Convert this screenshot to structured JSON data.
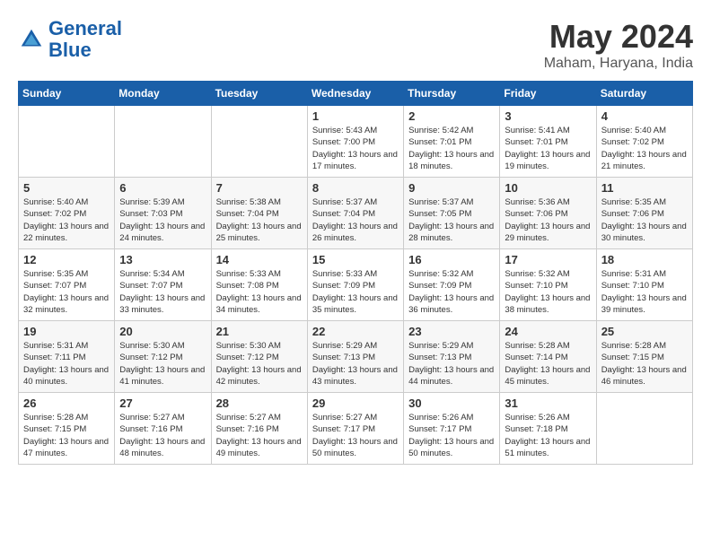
{
  "header": {
    "logo_line1": "General",
    "logo_line2": "Blue",
    "month": "May 2024",
    "location": "Maham, Haryana, India"
  },
  "weekdays": [
    "Sunday",
    "Monday",
    "Tuesday",
    "Wednesday",
    "Thursday",
    "Friday",
    "Saturday"
  ],
  "weeks": [
    [
      {
        "day": "",
        "sunrise": "",
        "sunset": "",
        "daylight": ""
      },
      {
        "day": "",
        "sunrise": "",
        "sunset": "",
        "daylight": ""
      },
      {
        "day": "",
        "sunrise": "",
        "sunset": "",
        "daylight": ""
      },
      {
        "day": "1",
        "sunrise": "Sunrise: 5:43 AM",
        "sunset": "Sunset: 7:00 PM",
        "daylight": "Daylight: 13 hours and 17 minutes."
      },
      {
        "day": "2",
        "sunrise": "Sunrise: 5:42 AM",
        "sunset": "Sunset: 7:01 PM",
        "daylight": "Daylight: 13 hours and 18 minutes."
      },
      {
        "day": "3",
        "sunrise": "Sunrise: 5:41 AM",
        "sunset": "Sunset: 7:01 PM",
        "daylight": "Daylight: 13 hours and 19 minutes."
      },
      {
        "day": "4",
        "sunrise": "Sunrise: 5:40 AM",
        "sunset": "Sunset: 7:02 PM",
        "daylight": "Daylight: 13 hours and 21 minutes."
      }
    ],
    [
      {
        "day": "5",
        "sunrise": "Sunrise: 5:40 AM",
        "sunset": "Sunset: 7:02 PM",
        "daylight": "Daylight: 13 hours and 22 minutes."
      },
      {
        "day": "6",
        "sunrise": "Sunrise: 5:39 AM",
        "sunset": "Sunset: 7:03 PM",
        "daylight": "Daylight: 13 hours and 24 minutes."
      },
      {
        "day": "7",
        "sunrise": "Sunrise: 5:38 AM",
        "sunset": "Sunset: 7:04 PM",
        "daylight": "Daylight: 13 hours and 25 minutes."
      },
      {
        "day": "8",
        "sunrise": "Sunrise: 5:37 AM",
        "sunset": "Sunset: 7:04 PM",
        "daylight": "Daylight: 13 hours and 26 minutes."
      },
      {
        "day": "9",
        "sunrise": "Sunrise: 5:37 AM",
        "sunset": "Sunset: 7:05 PM",
        "daylight": "Daylight: 13 hours and 28 minutes."
      },
      {
        "day": "10",
        "sunrise": "Sunrise: 5:36 AM",
        "sunset": "Sunset: 7:06 PM",
        "daylight": "Daylight: 13 hours and 29 minutes."
      },
      {
        "day": "11",
        "sunrise": "Sunrise: 5:35 AM",
        "sunset": "Sunset: 7:06 PM",
        "daylight": "Daylight: 13 hours and 30 minutes."
      }
    ],
    [
      {
        "day": "12",
        "sunrise": "Sunrise: 5:35 AM",
        "sunset": "Sunset: 7:07 PM",
        "daylight": "Daylight: 13 hours and 32 minutes."
      },
      {
        "day": "13",
        "sunrise": "Sunrise: 5:34 AM",
        "sunset": "Sunset: 7:07 PM",
        "daylight": "Daylight: 13 hours and 33 minutes."
      },
      {
        "day": "14",
        "sunrise": "Sunrise: 5:33 AM",
        "sunset": "Sunset: 7:08 PM",
        "daylight": "Daylight: 13 hours and 34 minutes."
      },
      {
        "day": "15",
        "sunrise": "Sunrise: 5:33 AM",
        "sunset": "Sunset: 7:09 PM",
        "daylight": "Daylight: 13 hours and 35 minutes."
      },
      {
        "day": "16",
        "sunrise": "Sunrise: 5:32 AM",
        "sunset": "Sunset: 7:09 PM",
        "daylight": "Daylight: 13 hours and 36 minutes."
      },
      {
        "day": "17",
        "sunrise": "Sunrise: 5:32 AM",
        "sunset": "Sunset: 7:10 PM",
        "daylight": "Daylight: 13 hours and 38 minutes."
      },
      {
        "day": "18",
        "sunrise": "Sunrise: 5:31 AM",
        "sunset": "Sunset: 7:10 PM",
        "daylight": "Daylight: 13 hours and 39 minutes."
      }
    ],
    [
      {
        "day": "19",
        "sunrise": "Sunrise: 5:31 AM",
        "sunset": "Sunset: 7:11 PM",
        "daylight": "Daylight: 13 hours and 40 minutes."
      },
      {
        "day": "20",
        "sunrise": "Sunrise: 5:30 AM",
        "sunset": "Sunset: 7:12 PM",
        "daylight": "Daylight: 13 hours and 41 minutes."
      },
      {
        "day": "21",
        "sunrise": "Sunrise: 5:30 AM",
        "sunset": "Sunset: 7:12 PM",
        "daylight": "Daylight: 13 hours and 42 minutes."
      },
      {
        "day": "22",
        "sunrise": "Sunrise: 5:29 AM",
        "sunset": "Sunset: 7:13 PM",
        "daylight": "Daylight: 13 hours and 43 minutes."
      },
      {
        "day": "23",
        "sunrise": "Sunrise: 5:29 AM",
        "sunset": "Sunset: 7:13 PM",
        "daylight": "Daylight: 13 hours and 44 minutes."
      },
      {
        "day": "24",
        "sunrise": "Sunrise: 5:28 AM",
        "sunset": "Sunset: 7:14 PM",
        "daylight": "Daylight: 13 hours and 45 minutes."
      },
      {
        "day": "25",
        "sunrise": "Sunrise: 5:28 AM",
        "sunset": "Sunset: 7:15 PM",
        "daylight": "Daylight: 13 hours and 46 minutes."
      }
    ],
    [
      {
        "day": "26",
        "sunrise": "Sunrise: 5:28 AM",
        "sunset": "Sunset: 7:15 PM",
        "daylight": "Daylight: 13 hours and 47 minutes."
      },
      {
        "day": "27",
        "sunrise": "Sunrise: 5:27 AM",
        "sunset": "Sunset: 7:16 PM",
        "daylight": "Daylight: 13 hours and 48 minutes."
      },
      {
        "day": "28",
        "sunrise": "Sunrise: 5:27 AM",
        "sunset": "Sunset: 7:16 PM",
        "daylight": "Daylight: 13 hours and 49 minutes."
      },
      {
        "day": "29",
        "sunrise": "Sunrise: 5:27 AM",
        "sunset": "Sunset: 7:17 PM",
        "daylight": "Daylight: 13 hours and 50 minutes."
      },
      {
        "day": "30",
        "sunrise": "Sunrise: 5:26 AM",
        "sunset": "Sunset: 7:17 PM",
        "daylight": "Daylight: 13 hours and 50 minutes."
      },
      {
        "day": "31",
        "sunrise": "Sunrise: 5:26 AM",
        "sunset": "Sunset: 7:18 PM",
        "daylight": "Daylight: 13 hours and 51 minutes."
      },
      {
        "day": "",
        "sunrise": "",
        "sunset": "",
        "daylight": ""
      }
    ]
  ]
}
